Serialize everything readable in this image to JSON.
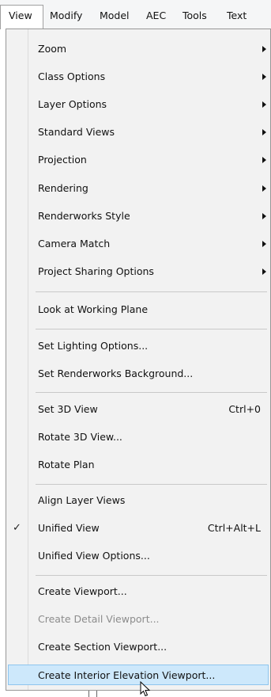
{
  "menubar": {
    "items": [
      "View",
      "Modify",
      "Model",
      "AEC",
      "Tools",
      "Text"
    ]
  },
  "dropdown": {
    "items": [
      {
        "label": "Zoom",
        "submenu": true
      },
      {
        "label": "Class Options",
        "submenu": true
      },
      {
        "label": "Layer Options",
        "submenu": true
      },
      {
        "label": "Standard Views",
        "submenu": true
      },
      {
        "label": "Projection",
        "submenu": true
      },
      {
        "label": "Rendering",
        "submenu": true
      },
      {
        "label": "Renderworks Style",
        "submenu": true
      },
      {
        "label": "Camera Match",
        "submenu": true
      },
      {
        "label": "Project Sharing Options",
        "submenu": true
      },
      {
        "label": "Look at Working Plane"
      },
      {
        "label": "Set Lighting Options..."
      },
      {
        "label": "Set Renderworks Background..."
      },
      {
        "label": "Set 3D View",
        "shortcut": "Ctrl+0"
      },
      {
        "label": "Rotate 3D View..."
      },
      {
        "label": "Rotate Plan"
      },
      {
        "label": "Align Layer Views"
      },
      {
        "label": "Unified View",
        "shortcut": "Ctrl+Alt+L",
        "checked": true,
        "check_glyph": "✓"
      },
      {
        "label": "Unified View Options..."
      },
      {
        "label": "Create Viewport..."
      },
      {
        "label": "Create Detail Viewport...",
        "disabled": true
      },
      {
        "label": "Create Section Viewport..."
      },
      {
        "label": "Create Interior Elevation Viewport...",
        "highlighted": true
      }
    ]
  },
  "colors": {
    "highlight_fill": "#cde8fb",
    "highlight_border": "#8ec5ee",
    "disabled_text": "#8c8c8c",
    "menu_background": "#f2f2f2"
  }
}
